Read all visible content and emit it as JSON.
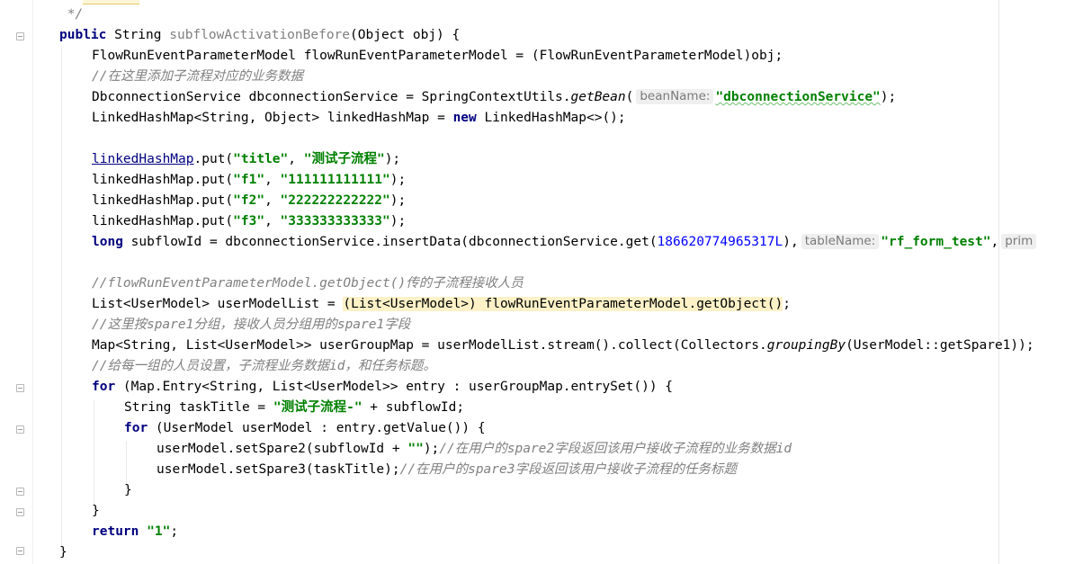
{
  "editor": {
    "l1_doc": " */",
    "l2": {
      "kw_public": "public",
      "rest": " String ",
      "method": "subflowActivationBefore",
      "params": "(Object obj) {"
    },
    "l3": "FlowRunEventParameterModel flowRunEventParameterModel = (FlowRunEventParameterModel)obj;",
    "l4_comment": "//在这里添加子流程对应的业务数据",
    "l5": {
      "pre": "DbconnectionService dbconnectionService = SpringContextUtils.",
      "call": "getBean",
      "open": "(",
      "hint": "beanName:",
      "str": "\"dbconnectionService\"",
      "close": ");"
    },
    "l6": {
      "pre": "LinkedHashMap<String, Object> linkedHashMap = ",
      "kw_new": "new",
      "post": " LinkedHashMap<>();"
    },
    "l7": {
      "var": "linkedHashMap",
      "call": ".put(",
      "s1": "\"title\"",
      "sep": ", ",
      "s2": "\"测试子流程\"",
      "end": ");"
    },
    "l8": {
      "pre": "linkedHashMap.put(",
      "s1": "\"f1\"",
      "sep": ", ",
      "s2": "\"111111111111\"",
      "end": ");"
    },
    "l9": {
      "pre": "linkedHashMap.put(",
      "s1": "\"f2\"",
      "sep": ", ",
      "s2": "\"222222222222\"",
      "end": ");"
    },
    "l10": {
      "pre": "linkedHashMap.put(",
      "s1": "\"f3\"",
      "sep": ", ",
      "s2": "\"333333333333\"",
      "end": ");"
    },
    "l11": {
      "kw_long": "long",
      "pre": " subflowId = dbconnectionService.insertData(dbconnectionService.get(",
      "num": "186620774965317L",
      "mid": "),",
      "hint": "tableName:",
      "str": "\"rf_form_test\"",
      "comma": ",",
      "hint2": "prim"
    },
    "l12_comment": "//flowRunEventParameterModel.getObject()传的子流程接收人员",
    "l13": {
      "pre": "List<UserModel> userModelList = ",
      "hl": "(List<UserModel>) flowRunEventParameterModel.getObject()",
      "end": ";"
    },
    "l14_comment": "//这里按spare1分组，接收人员分组用的spare1字段",
    "l15": {
      "pre": "Map<String, List<UserModel>> userGroupMap = userModelList.stream().collect(Collectors.",
      "call": "groupingBy",
      "post": "(UserModel::getSpare1));"
    },
    "l16_comment": "//给每一组的人员设置，子流程业务数据id，和任务标题。",
    "l17": {
      "kw_for": "for",
      "rest": " (Map.Entry<String, List<UserModel>> entry : userGroupMap.entrySet()) {"
    },
    "l18": {
      "pre": "String taskTitle = ",
      "str": "\"测试子流程-\"",
      "post": " + subflowId;"
    },
    "l19": {
      "kw_for": "for",
      "rest": " (UserModel userModel : entry.getValue()) {"
    },
    "l20": {
      "pre": "userModel.setSpare2(subflowId + ",
      "str": "\"\"",
      "post": ");",
      "comment": "//在用户的spare2字段返回该用户接收子流程的业务数据id"
    },
    "l21": {
      "pre": "userModel.setSpare3(taskTitle);",
      "comment": "//在用户的spare3字段返回该用户接收子流程的任务标题"
    },
    "l22": "}",
    "l23": "}",
    "l24": {
      "kw_return": "return",
      "str": "\"1\"",
      "end": ";"
    },
    "l25": "}"
  },
  "colors": {
    "keyword": "#000080",
    "string": "#008000",
    "number": "#0000ff",
    "comment": "#808080",
    "highlight": "#fdf1c8"
  }
}
